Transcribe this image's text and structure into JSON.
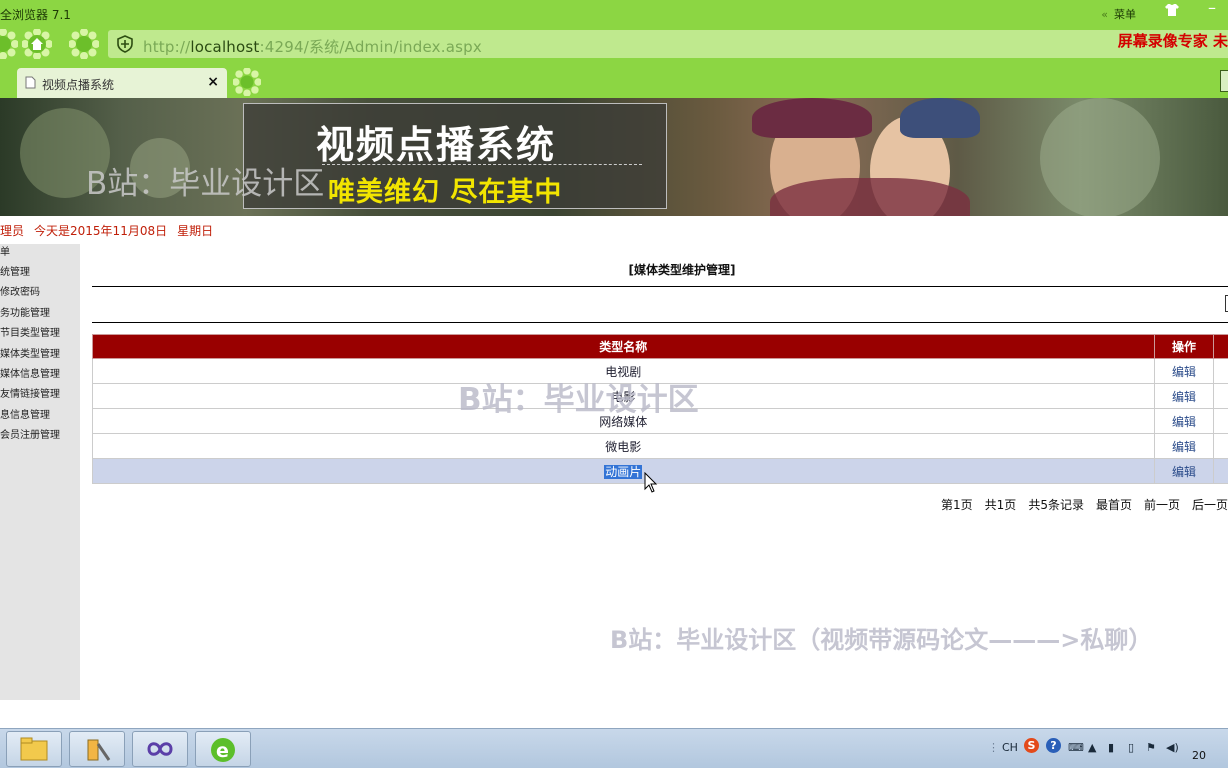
{
  "browser": {
    "title": "全浏览器 7.1",
    "menu_label": "菜单",
    "url_scheme": "http://",
    "url_host": "localhost",
    "url_rest": ":4294/系统/Admin/index.aspx",
    "recorder_text": "屏幕录像专家  未",
    "tab_title": "视频点播系统",
    "tab_close": "×",
    "accent_color": "#8cd643"
  },
  "banner": {
    "title": "视频点播系统",
    "slogan": "唯美维幻 尽在其中",
    "watermark": "B站：毕业设计区"
  },
  "dateline": {
    "user": "理员",
    "date": "今天是2015年11月08日",
    "weekday": "星期日"
  },
  "leftmenu": {
    "items": [
      "单",
      "统管理",
      "修改密码",
      "务功能管理",
      "节目类型管理",
      "媒体类型管理",
      "媒体信息管理",
      "友情链接管理",
      "息信息管理",
      "会员注册管理"
    ]
  },
  "main": {
    "title": "[媒体类型维护管理]",
    "table": {
      "headers": [
        "类型名称",
        "操作"
      ],
      "rows": [
        {
          "name": "电视剧",
          "op": "编辑"
        },
        {
          "name": "电影",
          "op": "编辑"
        },
        {
          "name": "网络媒体",
          "op": "编辑"
        },
        {
          "name": "微电影",
          "op": "编辑"
        },
        {
          "name": "动画片",
          "op": "编辑"
        }
      ],
      "header_color": "#990000"
    },
    "pager": {
      "page": "第1页",
      "total_pages": "共1页",
      "total_records": "共5条记录",
      "first": "最首页",
      "prev": "前一页",
      "next": "后一页"
    }
  },
  "watermarks": {
    "center": "B站：毕业设计区",
    "bottom": "B站：毕业设计区（视频带源码论文———>私聊）"
  },
  "taskbar": {
    "lang": "CH",
    "clock": "20"
  }
}
